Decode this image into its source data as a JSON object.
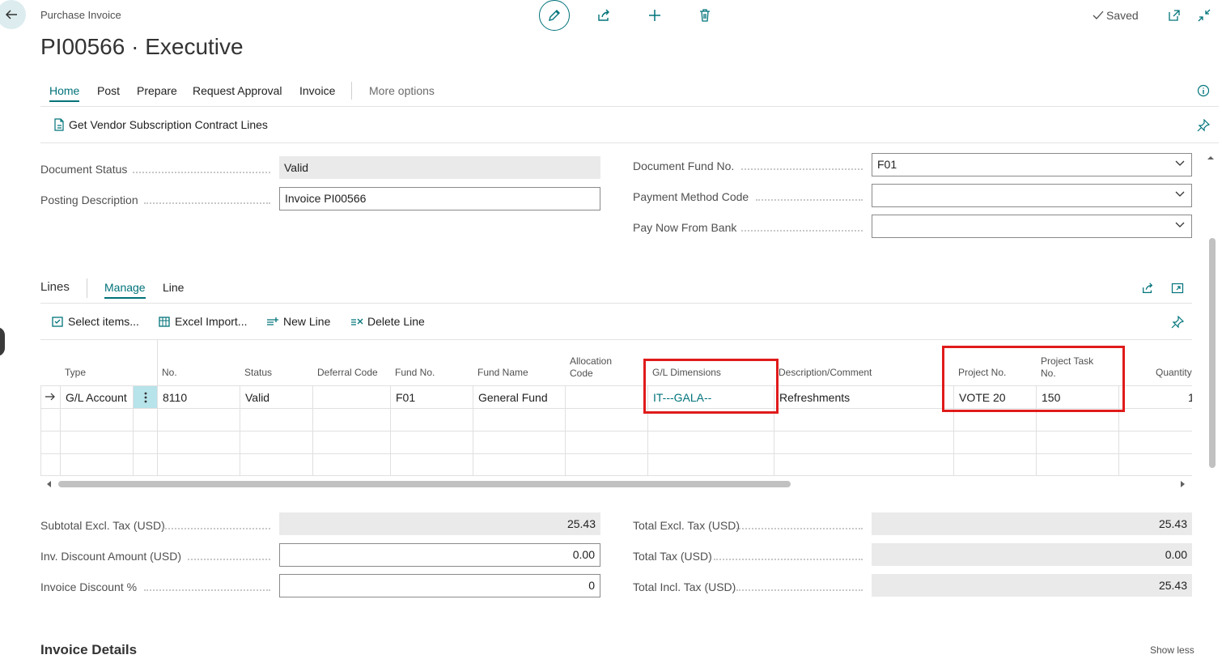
{
  "header": {
    "breadcrumb": "Purchase Invoice",
    "title": "PI00566 · Executive",
    "saved_label": "Saved"
  },
  "icons": {
    "back": "arrow-left-icon",
    "edit": "pencil-icon",
    "share": "share-icon",
    "new": "plus-icon",
    "delete": "trash-icon",
    "saved": "checkmark-icon",
    "open_new_window": "open-in-new-window-icon",
    "collapse": "collapse-icon",
    "info": "info-icon",
    "pin": "pin-icon",
    "dropdown": "chevron-down-icon"
  },
  "action_tabs": [
    "Home",
    "Post",
    "Prepare",
    "Request Approval",
    "Invoice"
  ],
  "more_options": "More options",
  "action_bar": {
    "get_contract_lines": "Get Vendor Subscription Contract Lines"
  },
  "general": {
    "document_status_label": "Document Status",
    "document_status_value": "Valid",
    "posting_description_label": "Posting Description",
    "posting_description_value": "Invoice PI00566",
    "document_fund_label": "Document Fund No.",
    "document_fund_value": "F01",
    "payment_method_label": "Payment Method Code",
    "payment_method_value": "",
    "pay_now_label": "Pay Now From Bank",
    "pay_now_value": ""
  },
  "lines": {
    "title": "Lines",
    "tabs": [
      "Manage",
      "Line"
    ],
    "actions": {
      "select_items": "Select items...",
      "excel_import": "Excel Import...",
      "new_line": "New Line",
      "delete_line": "Delete Line"
    },
    "columns": {
      "type": "Type",
      "no": "No.",
      "status": "Status",
      "deferral": "Deferral Code",
      "fund_no": "Fund No.",
      "fund_name": "Fund Name",
      "allocation_1": "Allocation",
      "allocation_2": "Code",
      "gl_dimensions": "G/L Dimensions",
      "description": "Description/Comment",
      "project_no": "Project No.",
      "project_task_1": "Project Task",
      "project_task_2": "No.",
      "quantity": "Quantity"
    },
    "row": {
      "type": "G/L Account",
      "no": "8110",
      "status": "Valid",
      "deferral": "",
      "fund_no": "F01",
      "fund_name": "General Fund",
      "allocation": "",
      "gl_dimensions": "IT---GALA--",
      "description": "Refreshments",
      "project_no": "VOTE 20",
      "project_task": "150",
      "quantity": "1"
    }
  },
  "totals": {
    "subtotal_label": "Subtotal Excl. Tax (USD)",
    "subtotal_value": "25.43",
    "inv_discount_label": "Inv. Discount Amount (USD)",
    "inv_discount_value": "0.00",
    "invoice_discount_pct_label": "Invoice Discount %",
    "invoice_discount_pct_value": "0",
    "total_excl_label": "Total Excl. Tax (USD)",
    "total_excl_value": "25.43",
    "total_tax_label": "Total Tax (USD)",
    "total_tax_value": "0.00",
    "total_incl_label": "Total Incl. Tax (USD)",
    "total_incl_value": "25.43"
  },
  "invoice_details": {
    "title": "Invoice Details",
    "show_less": "Show less"
  },
  "colors": {
    "accent": "#00737a",
    "highlight": "#e01b1b"
  }
}
